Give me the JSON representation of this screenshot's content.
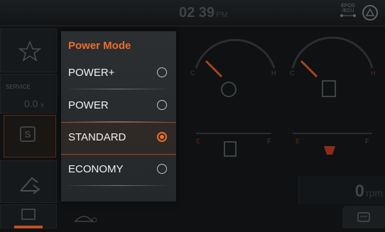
{
  "header": {
    "time": "02 39",
    "ampm": "PM",
    "epos_line1": "EPOS",
    "epos_line2": "/ECU"
  },
  "service": {
    "label": "SERVICE",
    "value": "0.0",
    "unit": "h"
  },
  "s_button": {
    "label": "S"
  },
  "popup": {
    "title": "Power Mode",
    "options": [
      {
        "label": "POWER+",
        "selected": false
      },
      {
        "label": "POWER",
        "selected": false
      },
      {
        "label": "STANDARD",
        "selected": true
      },
      {
        "label": "ECONOMY",
        "selected": false
      }
    ]
  },
  "gauges": {
    "left_min": "C",
    "left_max": "H",
    "right_min": "C",
    "right_max": "H",
    "fuel_min": "E",
    "fuel_max": "F",
    "def_min": "E",
    "def_max": "F"
  },
  "rpm": {
    "value": "0",
    "unit": "rpm"
  },
  "colors": {
    "accent": "#ee6c2a",
    "background": "#0f1112",
    "popup_bg": "#2a2d2f"
  }
}
